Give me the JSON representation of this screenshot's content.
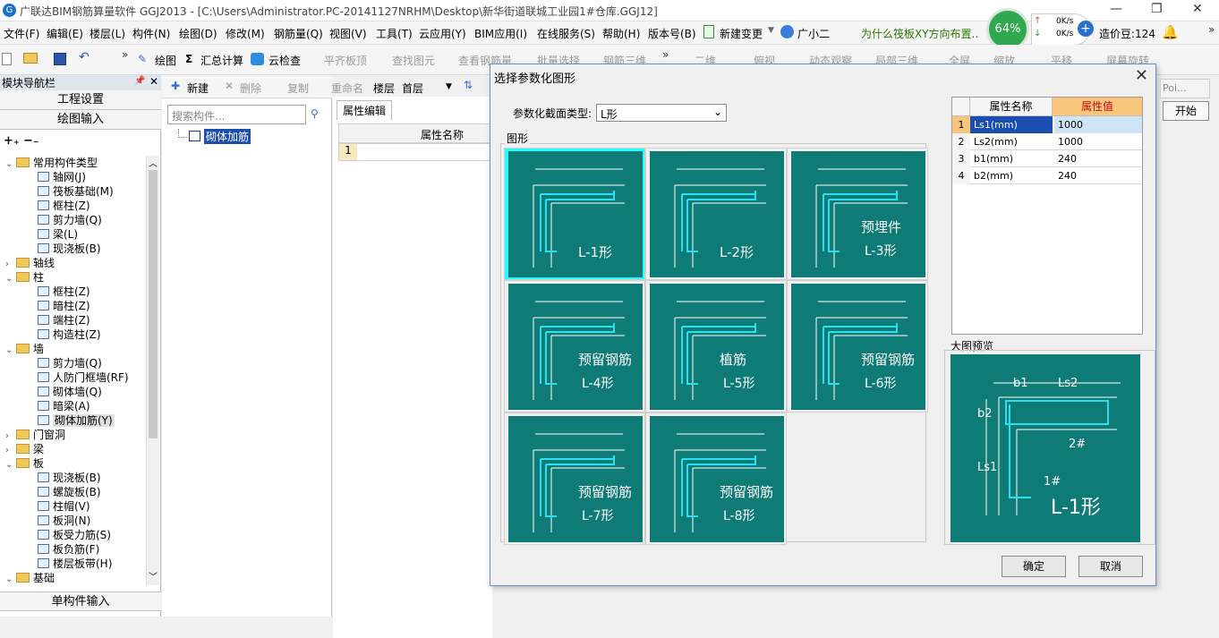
{
  "window": {
    "title": "广联达BIM钢筋算量软件 GGJ2013 - [C:\\Users\\Administrator.PC-20141127NRHM\\Desktop\\新华街道联城工业园1#仓库.GGJ12]",
    "min": "—",
    "max": "❐",
    "close": "✕"
  },
  "menu": [
    "文件(F)",
    "编辑(E)",
    "楼层(L)",
    "构件(N)",
    "绘图(D)",
    "修改(M)",
    "钢筋量(Q)",
    "视图(V)",
    "工具(T)",
    "云应用(Y)",
    "BIM应用(I)",
    "在线服务(S)",
    "帮助(H)",
    "版本号(B)",
    "新建变更",
    "广小二"
  ],
  "menu_extra": {
    "ticker": "为什么筏板XY方向布置..",
    "cost_label": "造价豆:124"
  },
  "network": {
    "percent": "64%",
    "up": "0K/s",
    "down": "0K/s"
  },
  "toolbar": [
    "绘图",
    "Σ",
    "汇总计算",
    "云检查",
    "平齐板顶",
    "查找图元",
    "查看钢筋量",
    "批量选择",
    "钢筋三维",
    "二维",
    "俯视",
    "动态观察",
    "局部三维",
    "全屏",
    "缩放",
    "平移",
    "屏幕旋转"
  ],
  "nav": {
    "header": "模块导航栏",
    "btn_settings": "工程设置",
    "btn_draw": "绘图输入",
    "btn_single": "单构件输入",
    "tree": [
      {
        "label": "常用构件类型",
        "level": 0,
        "folder": true,
        "exp": "v"
      },
      {
        "label": "轴网(J)",
        "level": 1
      },
      {
        "label": "筏板基础(M)",
        "level": 1
      },
      {
        "label": "框柱(Z)",
        "level": 1
      },
      {
        "label": "剪力墙(Q)",
        "level": 1
      },
      {
        "label": "梁(L)",
        "level": 1
      },
      {
        "label": "现浇板(B)",
        "level": 1
      },
      {
        "label": "轴线",
        "level": 0,
        "folder": true,
        "exp": ">"
      },
      {
        "label": "柱",
        "level": 0,
        "folder": true,
        "exp": "v"
      },
      {
        "label": "框柱(Z)",
        "level": 1
      },
      {
        "label": "暗柱(Z)",
        "level": 1
      },
      {
        "label": "端柱(Z)",
        "level": 1
      },
      {
        "label": "构造柱(Z)",
        "level": 1
      },
      {
        "label": "墙",
        "level": 0,
        "folder": true,
        "exp": "v"
      },
      {
        "label": "剪力墙(Q)",
        "level": 1
      },
      {
        "label": "人防门框墙(RF)",
        "level": 1
      },
      {
        "label": "砌体墙(Q)",
        "level": 1
      },
      {
        "label": "暗梁(A)",
        "level": 1
      },
      {
        "label": "砌体加筋(Y)",
        "level": 1,
        "sel": true
      },
      {
        "label": "门窗洞",
        "level": 0,
        "folder": true,
        "exp": ">"
      },
      {
        "label": "梁",
        "level": 0,
        "folder": true,
        "exp": ">"
      },
      {
        "label": "板",
        "level": 0,
        "folder": true,
        "exp": "v"
      },
      {
        "label": "现浇板(B)",
        "level": 1
      },
      {
        "label": "螺旋板(B)",
        "level": 1
      },
      {
        "label": "柱帽(V)",
        "level": 1
      },
      {
        "label": "板洞(N)",
        "level": 1
      },
      {
        "label": "板受力筋(S)",
        "level": 1
      },
      {
        "label": "板负筋(F)",
        "level": 1
      },
      {
        "label": "楼层板带(H)",
        "level": 1
      },
      {
        "label": "基础",
        "level": 0,
        "folder": true,
        "exp": "v"
      }
    ]
  },
  "mid": {
    "new": "新建",
    "delete": "删除",
    "copy": "复制",
    "rename": "重命名",
    "floor_label": "楼层",
    "floor_value": "首层",
    "search_placeholder": "搜索构件...",
    "component": "砌体加筋"
  },
  "props": {
    "tab": "属性编辑",
    "col_name": "属性名称",
    "row1": "1"
  },
  "dialog": {
    "title": "选择参数化图形",
    "type_label": "参数化截面类型:",
    "type_value": "L形",
    "group_label": "图形",
    "tiles": [
      {
        "label": "L-1形",
        "sel": true
      },
      {
        "label": "L-2形"
      },
      {
        "label": "预埋件",
        "label2": "L-3形"
      },
      {
        "label": "预留钢筋",
        "label2": "L-4形"
      },
      {
        "label": "植筋",
        "label2": "L-5形"
      },
      {
        "label": "预留钢筋",
        "label2": "L-6形"
      },
      {
        "label": "预留钢筋",
        "label2": "L-7形"
      },
      {
        "label": "预留钢筋",
        "label2": "L-8形"
      }
    ],
    "table": {
      "col_name": "属性名称",
      "col_value": "属性值",
      "rows": [
        {
          "no": "1",
          "name": "Ls1(mm)",
          "value": "1000"
        },
        {
          "no": "2",
          "name": "Ls2(mm)",
          "value": "1000"
        },
        {
          "no": "3",
          "name": "b1(mm)",
          "value": "240"
        },
        {
          "no": "4",
          "name": "b2(mm)",
          "value": "240"
        }
      ]
    },
    "preview_label": "大图预览",
    "preview_caption": "L-1形",
    "dims": {
      "b1": "b1",
      "b2": "b2",
      "ls1": "Ls1",
      "ls2": "Ls2",
      "bar1": "1#",
      "bar2": "2#"
    },
    "ok": "确定",
    "cancel": "取消"
  },
  "right_panel": {
    "tab": "Poi...",
    "start": "开始"
  },
  "colors": {
    "tile_bg": "#0f7b76",
    "bar": "#28e0f0",
    "selected": "#2ff0f5",
    "table_header_value": "#f7c67a",
    "nav_header": "#dfe6ee"
  }
}
